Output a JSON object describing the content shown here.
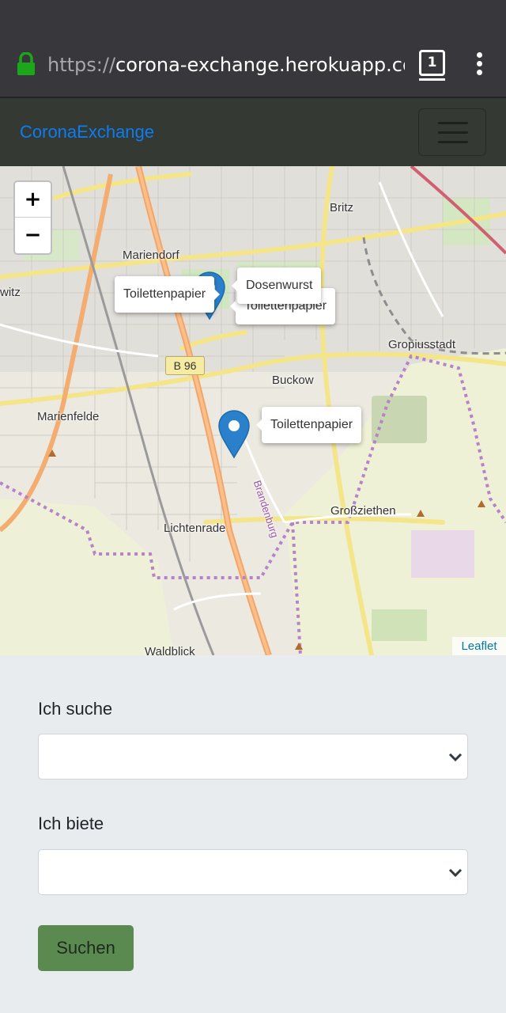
{
  "browser": {
    "url_scheme": "https://",
    "url_host": "corona-exchange.herokuapp.com/",
    "tab_count": "1",
    "icons": [
      "lock-icon",
      "tabs-icon",
      "menu-kebab-icon"
    ],
    "colors": {
      "chrome": "#38383c",
      "lock": "#1ca71a"
    }
  },
  "navbar": {
    "brand": "CoronaExchange",
    "icons": [
      "hamburger-icon"
    ],
    "colors": {
      "background": "#343a33",
      "brand": "#0d7cf0"
    }
  },
  "map": {
    "zoom_in": "+",
    "zoom_out": "−",
    "places": {
      "britz": "Britz",
      "mariendorf": "Mariendorf",
      "marienfelde": "Marienfelde",
      "buckow": "Buckow",
      "gropiusstadt": "Gropiusstadt",
      "lichtenrade": "Lichtenrade",
      "grossziethen": "Großziethen",
      "waldblick": "Waldblick",
      "brandenburg": "Brandenburg",
      "witz": "witz"
    },
    "road_badge": "B 96",
    "popups": [
      {
        "label": "Toilettenpapier"
      },
      {
        "label": "Dosenwurst"
      },
      {
        "label": "Toilettenpapier"
      },
      {
        "label": "Toilettenpapier"
      }
    ],
    "attribution": "Leaflet",
    "colors": {
      "marker": "#2a80cb",
      "boundary": "#b583c8"
    }
  },
  "form": {
    "search_label": "Ich suche",
    "search_value": "",
    "offer_label": "Ich biete",
    "offer_value": "",
    "submit_label": "Suchen",
    "colors": {
      "button": "#5b8a51"
    }
  }
}
